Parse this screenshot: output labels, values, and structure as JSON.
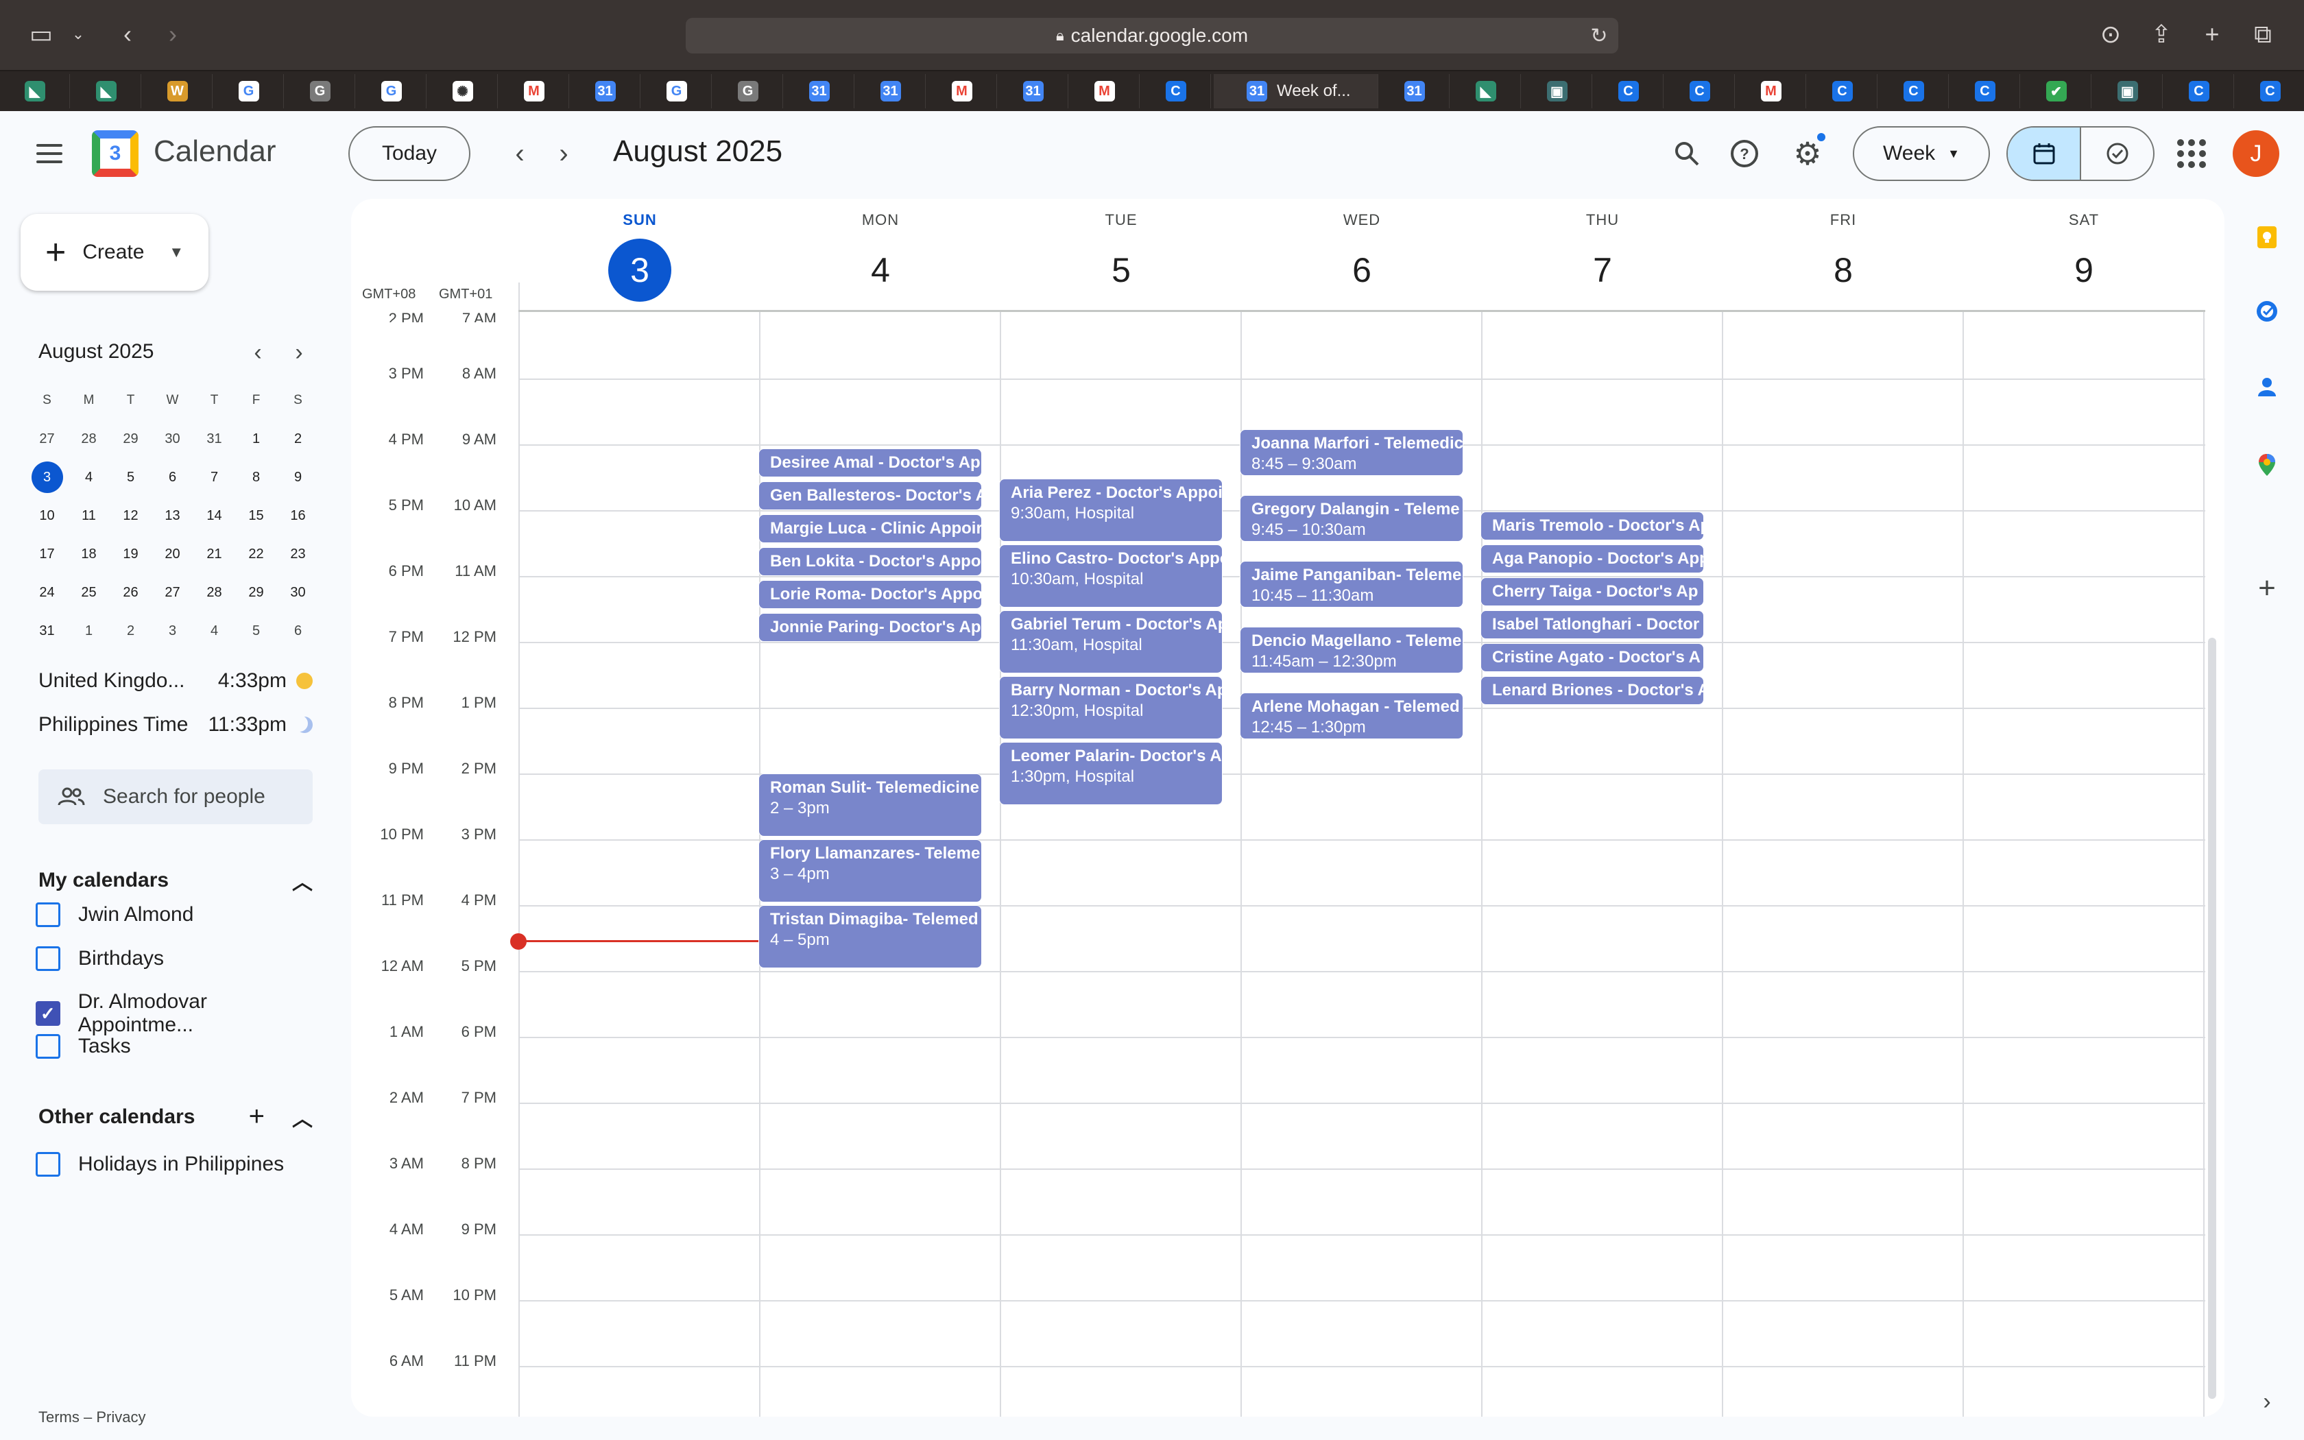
{
  "browser": {
    "url": "calendar.google.com",
    "active_tab_title": "Week of...",
    "tab_icons": [
      "maps-icon",
      "maps-icon",
      "w-icon",
      "google-icon",
      "g-icon",
      "google-icon",
      "chatgpt-icon",
      "gmail-icon",
      "calendar-icon",
      "google-icon",
      "g-icon",
      "calendar-icon",
      "calendar-icon",
      "gmail-icon",
      "calendar-icon",
      "gmail-icon",
      "c-icon",
      "calendar-icon",
      "maps-icon",
      "tablet-icon",
      "c-icon",
      "c-icon",
      "gmail-icon",
      "c-icon",
      "c-icon",
      "c-icon",
      "check-icon",
      "tablet-icon",
      "c-icon",
      "c-icon"
    ]
  },
  "header": {
    "app_name": "Calendar",
    "today_label": "Today",
    "month_title": "August 2025",
    "view_label": "Week",
    "avatar_initial": "J"
  },
  "sidebar": {
    "create_label": "Create",
    "mini_month": "August 2025",
    "mini_dow": [
      "S",
      "M",
      "T",
      "W",
      "T",
      "F",
      "S"
    ],
    "mini_days": [
      [
        "27",
        "28",
        "29",
        "30",
        "31",
        "1",
        "2"
      ],
      [
        "3",
        "4",
        "5",
        "6",
        "7",
        "8",
        "9"
      ],
      [
        "10",
        "11",
        "12",
        "13",
        "14",
        "15",
        "16"
      ],
      [
        "17",
        "18",
        "19",
        "20",
        "21",
        "22",
        "23"
      ],
      [
        "24",
        "25",
        "26",
        "27",
        "28",
        "29",
        "30"
      ],
      [
        "31",
        "1",
        "2",
        "3",
        "4",
        "5",
        "6"
      ]
    ],
    "timezones": [
      {
        "name": "United Kingdo...",
        "time": "4:33pm"
      },
      {
        "name": "Philippines Time",
        "time": "11:33pm"
      }
    ],
    "search_people": "Search for people",
    "my_calendars_title": "My calendars",
    "my_calendars": [
      {
        "name": "Jwin Almond",
        "checked": false
      },
      {
        "name": "Birthdays",
        "checked": false
      },
      {
        "name": "Dr. Almodovar Appointme...",
        "checked": true
      },
      {
        "name": "Tasks",
        "checked": false
      }
    ],
    "other_calendars_title": "Other calendars",
    "other_calendars": [
      {
        "name": "Holidays in Philippines",
        "checked": false
      }
    ],
    "footer": "Terms – Privacy"
  },
  "week": {
    "tz_primary": "GMT+08",
    "tz_secondary": "GMT+01",
    "days": [
      {
        "dow": "SUN",
        "num": "3"
      },
      {
        "dow": "MON",
        "num": "4"
      },
      {
        "dow": "TUE",
        "num": "5"
      },
      {
        "dow": "WED",
        "num": "6"
      },
      {
        "dow": "THU",
        "num": "7"
      },
      {
        "dow": "FRI",
        "num": "8"
      },
      {
        "dow": "SAT",
        "num": "9"
      }
    ],
    "times_primary": [
      "2 PM",
      "3 PM",
      "4 PM",
      "5 PM",
      "6 PM",
      "7 PM",
      "8 PM",
      "9 PM",
      "10 PM",
      "11 PM",
      "12 AM",
      "1 AM",
      "2 AM",
      "3 AM",
      "4 AM",
      "5 AM",
      "6 AM"
    ],
    "times_secondary": [
      "7 AM",
      "8 AM",
      "9 AM",
      "10 AM",
      "11 AM",
      "12 PM",
      "1 PM",
      "2 PM",
      "3 PM",
      "4 PM",
      "5 PM",
      "6 PM",
      "7 PM",
      "8 PM",
      "9 PM",
      "10 PM",
      "11 PM"
    ]
  },
  "events": {
    "mon": [
      {
        "title": "Desiree Amal - Doctor's Ap",
        "sub": ""
      },
      {
        "title": "Gen Ballesteros- Doctor's A",
        "sub": ""
      },
      {
        "title": "Margie Luca - Clinic Appoir",
        "sub": ""
      },
      {
        "title": "Ben Lokita - Doctor's Appo",
        "sub": ""
      },
      {
        "title": "Lorie Roma- Doctor's Appo",
        "sub": ""
      },
      {
        "title": "Jonnie Paring- Doctor's Ap",
        "sub": ""
      },
      {
        "title": "Roman Sulit- Telemedicine",
        "sub": "2 – 3pm"
      },
      {
        "title": "Flory Llamanzares- Teleme",
        "sub": "3 – 4pm"
      },
      {
        "title": "Tristan Dimagiba- Telemed",
        "sub": "4 – 5pm"
      }
    ],
    "tue": [
      {
        "title": "Aria Perez - Doctor's Appoi",
        "sub": "9:30am, Hospital"
      },
      {
        "title": "Elino Castro- Doctor's Appo",
        "sub": "10:30am, Hospital"
      },
      {
        "title": "Gabriel Terum - Doctor's Ap",
        "sub": "11:30am, Hospital"
      },
      {
        "title": "Barry Norman - Doctor's Ap",
        "sub": "12:30pm, Hospital"
      },
      {
        "title": "Leomer Palarin- Doctor's A",
        "sub": "1:30pm, Hospital"
      }
    ],
    "wed": [
      {
        "title": "Joanna Marfori - Telemedic",
        "sub": "8:45 – 9:30am"
      },
      {
        "title": "Gregory Dalangin - Teleme",
        "sub": "9:45 – 10:30am"
      },
      {
        "title": "Jaime Panganiban- Teleme",
        "sub": "10:45 – 11:30am"
      },
      {
        "title": "Dencio Magellano - Teleme",
        "sub": "11:45am – 12:30pm"
      },
      {
        "title": "Arlene Mohagan - Telemed",
        "sub": "12:45 – 1:30pm"
      }
    ],
    "thu": [
      {
        "title": "Maris Tremolo - Doctor's Ap",
        "sub": ""
      },
      {
        "title": "Aga Panopio - Doctor's App",
        "sub": ""
      },
      {
        "title": "Cherry Taiga - Doctor's Ap",
        "sub": ""
      },
      {
        "title": "Isabel Tatlonghari - Doctor",
        "sub": ""
      },
      {
        "title": "Cristine Agato - Doctor's A",
        "sub": ""
      },
      {
        "title": "Lenard Briones - Doctor's A",
        "sub": ""
      }
    ]
  },
  "colors": {
    "event": "#7986cb",
    "accent": "#0b57d0",
    "now": "#d93025"
  }
}
